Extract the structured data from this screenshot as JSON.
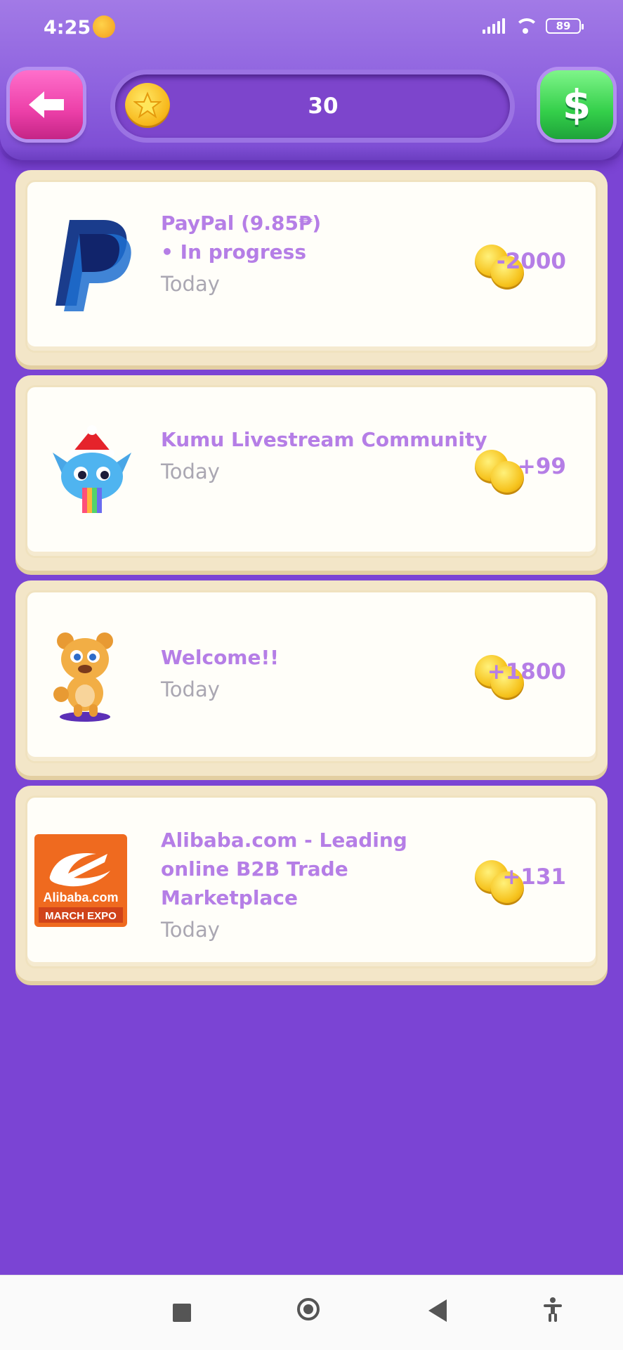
{
  "status_bar": {
    "time": "4:25",
    "battery": "89"
  },
  "header": {
    "coin_count": "30",
    "back_icon": "arrow-left-icon",
    "cash_icon": "dollar-icon"
  },
  "offers": [
    {
      "title": "PayPal (9.85₱)",
      "subtitle": "• In progress",
      "date": "Today",
      "reward": "-2000",
      "logo": "paypal-logo"
    },
    {
      "title": "Kumu Livestream Community",
      "subtitle": "",
      "date": "Today",
      "reward": "+99",
      "logo": "kumu-logo"
    },
    {
      "title": "Welcome!!",
      "subtitle": "",
      "date": "Today",
      "reward": "+1800",
      "logo": "bear-mascot"
    },
    {
      "title": "Alibaba.com - Leading online B2B Trade Marketplace",
      "subtitle": "",
      "date": "Today",
      "reward": "+131",
      "logo": "alibaba-logo",
      "logo_text": [
        "Alibaba.com",
        "MARCH EXPO"
      ]
    }
  ],
  "colors": {
    "background": "#7b44d4",
    "accent_text": "#b57ee6",
    "date_text": "#aaa7b2"
  }
}
